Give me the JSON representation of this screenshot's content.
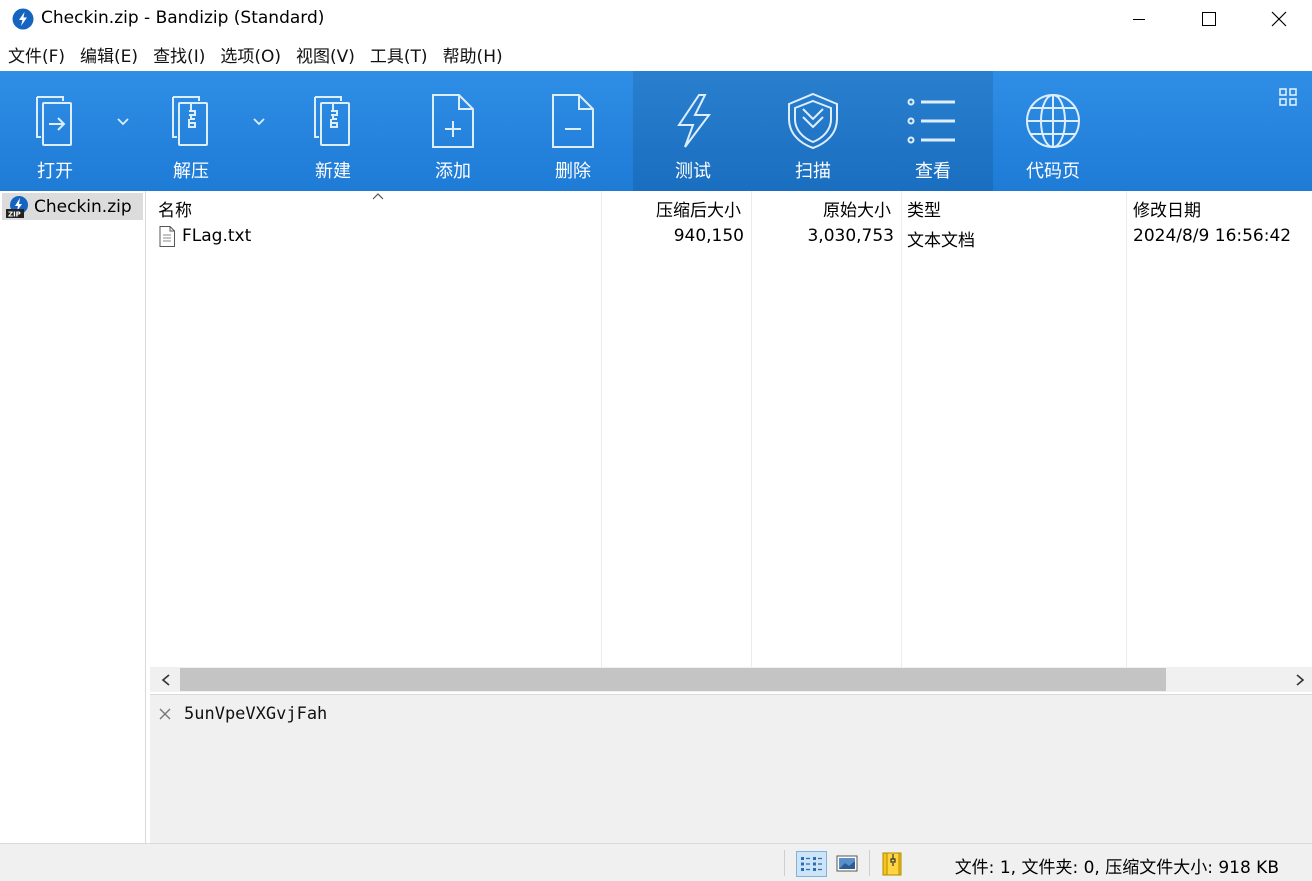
{
  "window": {
    "title": "Checkin.zip - Bandizip (Standard)",
    "icon": "bandizip-logo-icon",
    "controls": [
      "minimize-icon",
      "maximize-icon",
      "close-icon"
    ]
  },
  "menu": [
    "文件(F)",
    "编辑(E)",
    "查找(I)",
    "选项(O)",
    "视图(V)",
    "工具(T)",
    "帮助(H)"
  ],
  "toolbar": {
    "buttons": [
      {
        "label": "打开",
        "icon": "open-icon",
        "dropdown": true
      },
      {
        "label": "解压",
        "icon": "extract-icon",
        "dropdown": true
      },
      {
        "label": "新建",
        "icon": "new-archive-icon"
      },
      {
        "label": "添加",
        "icon": "add-icon"
      },
      {
        "label": "删除",
        "icon": "delete-icon"
      },
      {
        "label": "测试",
        "icon": "test-icon"
      },
      {
        "label": "扫描",
        "icon": "scan-icon"
      },
      {
        "label": "查看",
        "icon": "view-icon"
      },
      {
        "label": "代码页",
        "icon": "codepage-icon"
      }
    ],
    "accent": "#1e7bd6"
  },
  "tree": {
    "items": [
      {
        "label": "Checkin.zip",
        "icon": "zip-archive-icon"
      }
    ]
  },
  "filelist": {
    "columns": [
      "名称",
      "压缩后大小",
      "原始大小",
      "类型",
      "修改日期"
    ],
    "sort": {
      "column": "名称",
      "direction": "ascending"
    },
    "rows": [
      {
        "name": "FLag.txt",
        "packed": "940,150",
        "size": "3,030,753",
        "type": "文本文档",
        "modified": "2024/8/9 16:56:42",
        "icon": "text-file-icon"
      }
    ]
  },
  "comment": {
    "text": "5unVpeVXGvjFah"
  },
  "status": {
    "text": "文件: 1, 文件夹: 0, 压缩文件大小: 918 KB"
  }
}
